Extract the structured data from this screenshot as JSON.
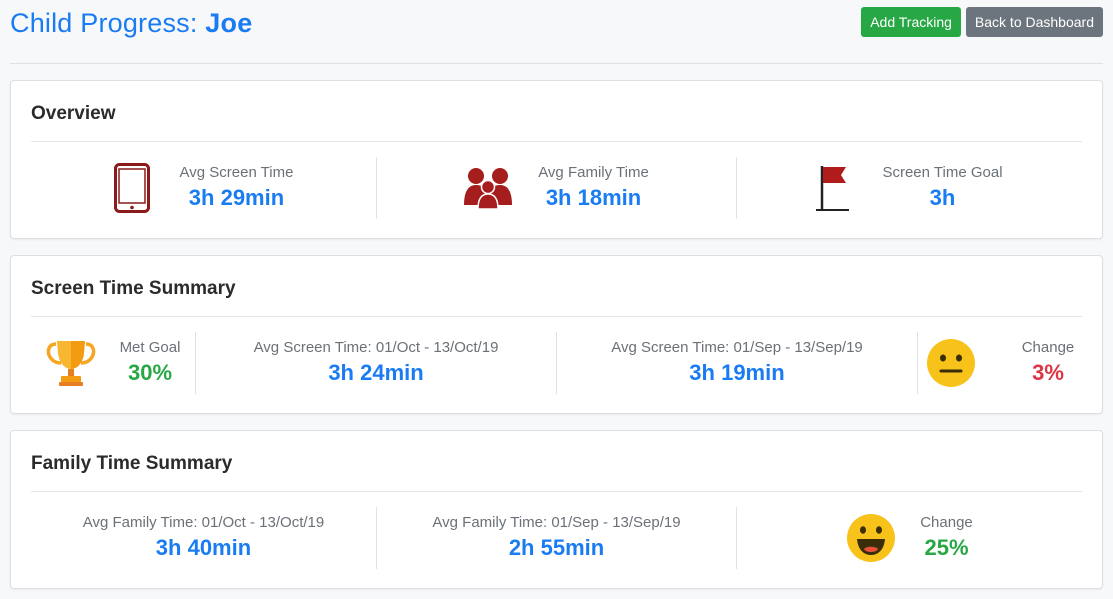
{
  "header": {
    "title_prefix": "Child Progress:",
    "child_name": "Joe",
    "add_tracking_label": "Add Tracking",
    "back_label": "Back to Dashboard"
  },
  "overview": {
    "title": "Overview",
    "stats": [
      {
        "label": "Avg Screen Time",
        "value": "3h 29min",
        "icon": "tablet-icon"
      },
      {
        "label": "Avg Family Time",
        "value": "3h 18min",
        "icon": "family-icon"
      },
      {
        "label": "Screen Time Goal",
        "value": "3h",
        "icon": "flag-icon"
      }
    ]
  },
  "screen_summary": {
    "title": "Screen Time Summary",
    "met_goal": {
      "label": "Met Goal",
      "value": "30%",
      "icon": "trophy-icon"
    },
    "current": {
      "label": "Avg Screen Time: 01/Oct - 13/Oct/19",
      "value": "3h 24min"
    },
    "previous": {
      "label": "Avg Screen Time: 01/Sep - 13/Sep/19",
      "value": "3h 19min"
    },
    "change": {
      "label": "Change",
      "value": "3%",
      "icon": "neutral-face-icon"
    }
  },
  "family_summary": {
    "title": "Family Time Summary",
    "current": {
      "label": "Avg Family Time: 01/Oct - 13/Oct/19",
      "value": "3h 40min"
    },
    "previous": {
      "label": "Avg Family Time: 01/Sep - 13/Sep/19",
      "value": "2h 55min"
    },
    "change": {
      "label": "Change",
      "value": "25%",
      "icon": "happy-face-icon"
    }
  },
  "colors": {
    "accent_blue": "#1a7cf2",
    "positive_green": "#28a745",
    "negative_red": "#dc3545",
    "icon_dark_red": "#8b1a1a",
    "emoji_yellow": "#f7c21a"
  }
}
